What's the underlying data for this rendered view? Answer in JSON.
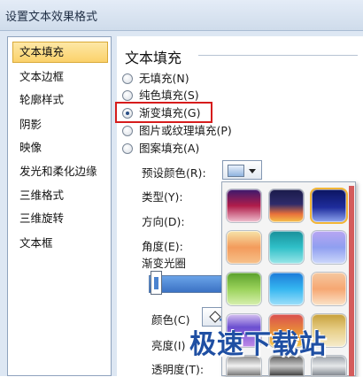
{
  "window": {
    "title": "设置文本效果格式"
  },
  "sidebar": {
    "items": [
      {
        "label": "文本填充",
        "selected": true
      },
      {
        "label": "文本边框",
        "selected": false
      },
      {
        "label": "轮廓样式",
        "selected": false
      },
      {
        "label": "阴影",
        "selected": false
      },
      {
        "label": "映像",
        "selected": false
      },
      {
        "label": "发光和柔化边缘",
        "selected": false
      },
      {
        "label": "三维格式",
        "selected": false
      },
      {
        "label": "三维旋转",
        "selected": false
      },
      {
        "label": "文本框",
        "selected": false
      }
    ]
  },
  "panel": {
    "title": "文本填充",
    "fill_options": [
      {
        "label": "无填充(N)",
        "checked": false
      },
      {
        "label": "纯色填充(S)",
        "checked": false
      },
      {
        "label": "渐变填充(G)",
        "checked": true
      },
      {
        "label": "图片或纹理填充(P)",
        "checked": false
      },
      {
        "label": "图案填充(A)",
        "checked": false
      }
    ],
    "preset_label": "预设颜色(R):",
    "type_label": "类型(Y):",
    "direction_label": "方向(D):",
    "angle_label": "角度(E):",
    "gradient_stops_label": "渐变光圈",
    "color_label": "颜色(C)",
    "brightness_label": "亮度(I)",
    "transparency_label": "透明度(T):"
  },
  "gallery": {
    "colors": {
      "accent_red": "#d61c1c",
      "selection": "#fbd26a"
    },
    "presets": [
      {
        "gradient": "linear-gradient(#3a1a6e,#b01c4a 50%,#f0c0d0)"
      },
      {
        "gradient": "linear-gradient(#1a1a4a,#2e2b6a 45%,#e8703a 75%,#f6c24a)"
      },
      {
        "gradient": "linear-gradient(#0c1560,#1e2c9c 55%,#8fa6f0)"
      },
      {
        "gradient": "linear-gradient(#f6e3a8,#f39b5c 50%,#f7c18a)"
      },
      {
        "gradient": "linear-gradient(#1a8f9a,#2fc0c8 50%,#9ae6e8)"
      },
      {
        "gradient": "linear-gradient(#b8a6f2,#8f9ff0 50%,#cdd8fb)"
      },
      {
        "gradient": "linear-gradient(#5aa02c,#9ad25a 50%,#d8f0b0)"
      },
      {
        "gradient": "linear-gradient(#1c7ad8,#35b6f0 50%,#9ee0fa)"
      },
      {
        "gradient": "linear-gradient(#f5c8a0,#f6a772 50%,#fbe3c8)"
      },
      {
        "gradient": "linear-gradient(#d6c1f0,#6b4fd0 40%,#c08ae8)"
      },
      {
        "gradient": "linear-gradient(#d94f4f,#e88a3a 50%,#f5c84a)"
      },
      {
        "gradient": "linear-gradient(#c7a03a,#e8d08a 50%,#f6eccd)"
      },
      {
        "gradient": "linear-gradient(#8a8a8a,#f2f2f2 50%,#6e6e6e)"
      },
      {
        "gradient": "linear-gradient(#5a5a5a,#c8c8c8 50%,#3a3a3a)"
      },
      {
        "gradient": "linear-gradient(#9aa0a8,#e6e8ea 50%,#7c828a)"
      }
    ]
  },
  "watermark": {
    "text": "极速下载站"
  }
}
